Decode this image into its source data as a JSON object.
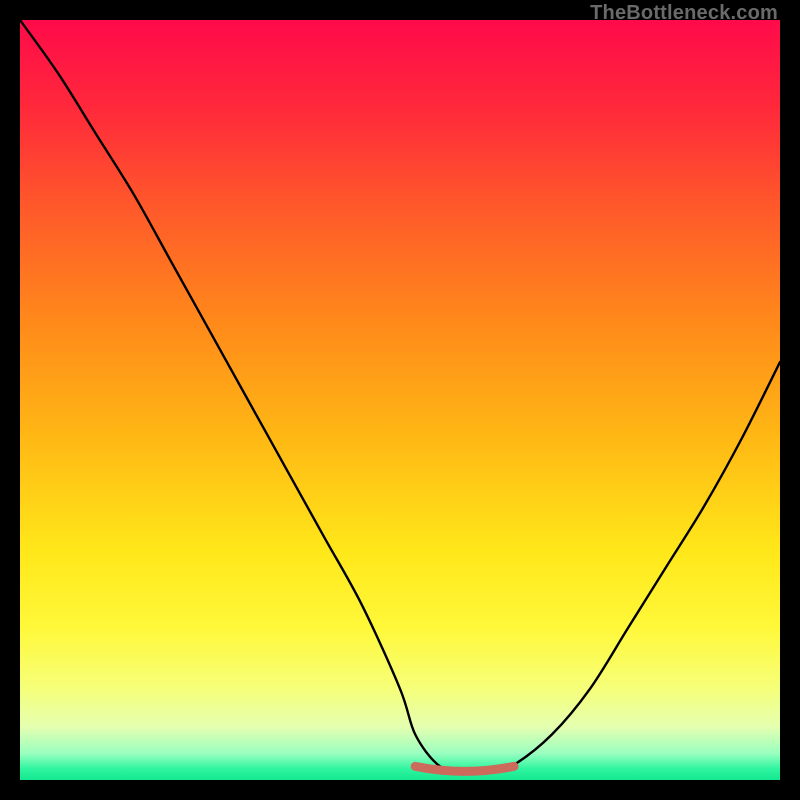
{
  "watermark": "TheBottleneck.com",
  "colors": {
    "frame": "#000000",
    "curve": "#000000",
    "bottom_marker": "#cc6a5c",
    "gradient_stops": [
      {
        "offset": 0.0,
        "color": "#ff0a4a"
      },
      {
        "offset": 0.12,
        "color": "#ff2a3a"
      },
      {
        "offset": 0.25,
        "color": "#ff5a2a"
      },
      {
        "offset": 0.4,
        "color": "#ff8a1a"
      },
      {
        "offset": 0.55,
        "color": "#ffb814"
      },
      {
        "offset": 0.7,
        "color": "#ffe81a"
      },
      {
        "offset": 0.8,
        "color": "#fff83a"
      },
      {
        "offset": 0.88,
        "color": "#f6ff7a"
      },
      {
        "offset": 0.93,
        "color": "#e4ffb0"
      },
      {
        "offset": 0.965,
        "color": "#9affc0"
      },
      {
        "offset": 0.985,
        "color": "#30f5a0"
      },
      {
        "offset": 1.0,
        "color": "#14e890"
      }
    ]
  },
  "chart_data": {
    "type": "line",
    "title": "",
    "xlabel": "",
    "ylabel": "",
    "xlim": [
      0,
      100
    ],
    "ylim": [
      0,
      100
    ],
    "series": [
      {
        "name": "bottleneck-curve",
        "x": [
          0,
          5,
          10,
          15,
          20,
          25,
          30,
          35,
          40,
          45,
          50,
          52,
          55,
          58,
          60,
          62,
          65,
          70,
          75,
          80,
          85,
          90,
          95,
          100
        ],
        "y": [
          100,
          93,
          85,
          77,
          68,
          59,
          50,
          41,
          32,
          23,
          12,
          6,
          2,
          1,
          1,
          1,
          2,
          6,
          12,
          20,
          28,
          36,
          45,
          55
        ]
      }
    ],
    "annotations": [
      {
        "name": "optimal-range-marker",
        "x_start": 52,
        "x_end": 65,
        "y": 1
      }
    ]
  }
}
